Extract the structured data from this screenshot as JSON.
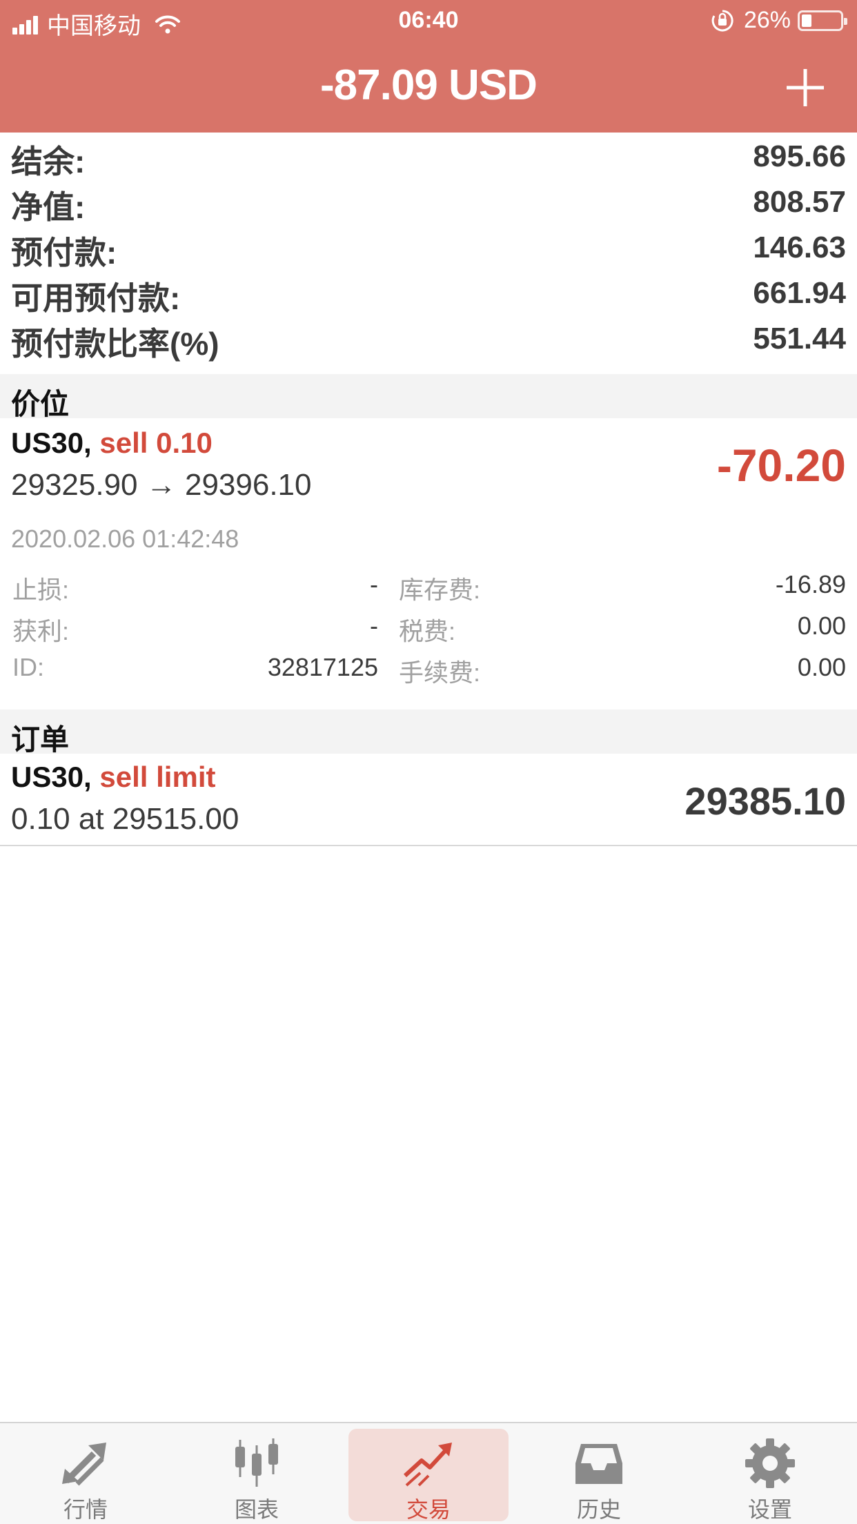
{
  "status_bar": {
    "carrier": "中国移动",
    "time": "06:40",
    "battery_percent": "26%",
    "battery_level": 0.26
  },
  "header": {
    "title": "-87.09 USD",
    "add_icon": "plus-icon"
  },
  "account": [
    {
      "label": "结余:",
      "value": "895.66"
    },
    {
      "label": "净值:",
      "value": "808.57"
    },
    {
      "label": "预付款:",
      "value": "146.63"
    },
    {
      "label": "可用预付款:",
      "value": "661.94"
    },
    {
      "label": "预付款比率(%)",
      "value": "551.44"
    }
  ],
  "positions_section": {
    "label": "价位"
  },
  "position": {
    "symbol": "US30,",
    "direction": "sell 0.10",
    "prices": "29325.90 → 29396.10",
    "profit": "-70.20",
    "open_time": "2020.02.06 01:42:48",
    "details": {
      "stop_loss_label": "止损:",
      "stop_loss_value": "-",
      "take_profit_label": "获利:",
      "take_profit_value": "-",
      "id_label": "ID:",
      "id_value": "32817125",
      "swap_label": "库存费:",
      "swap_value": "-16.89",
      "tax_label": "税费:",
      "tax_value": "0.00",
      "commission_label": "手续费:",
      "commission_value": "0.00"
    }
  },
  "orders_section": {
    "label": "订单"
  },
  "order": {
    "symbol": "US30,",
    "type": "sell limit",
    "volume_price": "0.10 at 29515.00",
    "current_price": "29385.10"
  },
  "tabs": [
    {
      "label": "行情",
      "icon": "quotes-arrows-icon",
      "active": false
    },
    {
      "label": "图表",
      "icon": "candlestick-chart-icon",
      "active": false
    },
    {
      "label": "交易",
      "icon": "trade-trend-icon",
      "active": true
    },
    {
      "label": "历史",
      "icon": "history-inbox-icon",
      "active": false
    },
    {
      "label": "设置",
      "icon": "settings-gear-icon",
      "active": false
    }
  ],
  "colors": {
    "header_bg": "#d87469",
    "loss_red": "#d24a3b",
    "active_tab_bg": "#f3dcd8"
  }
}
